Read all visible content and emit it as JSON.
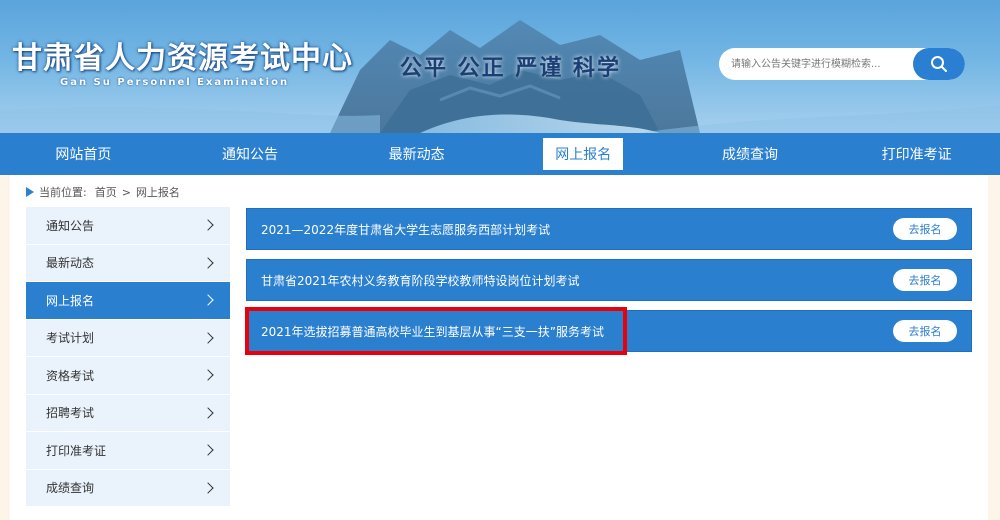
{
  "header": {
    "site_title": "甘肃省人力资源考试中心",
    "site_subtitle": "Gan Su Personnel Examination",
    "slogan": "公平 公正 严谨 科学",
    "search": {
      "placeholder": "请输入公告关键字进行模糊检索..."
    }
  },
  "nav": {
    "items": [
      {
        "label": "网站首页"
      },
      {
        "label": "通知公告"
      },
      {
        "label": "最新动态"
      },
      {
        "label": "网上报名",
        "active": true
      },
      {
        "label": "成绩查询"
      },
      {
        "label": "打印准考证"
      }
    ]
  },
  "breadcrumb": {
    "prefix": "当前位置:",
    "home": "首页",
    "separator": ">",
    "current": "网上报名"
  },
  "sidebar": {
    "items": [
      {
        "label": "通知公告"
      },
      {
        "label": "最新动态"
      },
      {
        "label": "网上报名",
        "active": true
      },
      {
        "label": "考试计划"
      },
      {
        "label": "资格考试"
      },
      {
        "label": "招聘考试"
      },
      {
        "label": "打印准考证"
      },
      {
        "label": "成绩查询"
      }
    ]
  },
  "exams": {
    "register_label": "去报名",
    "items": [
      {
        "title": "2021—2022年度甘肃省大学生志愿服务西部计划考试"
      },
      {
        "title": "甘肃省2021年农村义务教育阶段学校教师特设岗位计划考试"
      },
      {
        "title": "2021年选拔招募普通高校毕业生到基层从事“三支一扶”服务考试"
      }
    ]
  },
  "colors": {
    "primary": "#2a7fcf",
    "sidebar_bg": "#eaf3fc",
    "highlight": "#e8000b"
  }
}
